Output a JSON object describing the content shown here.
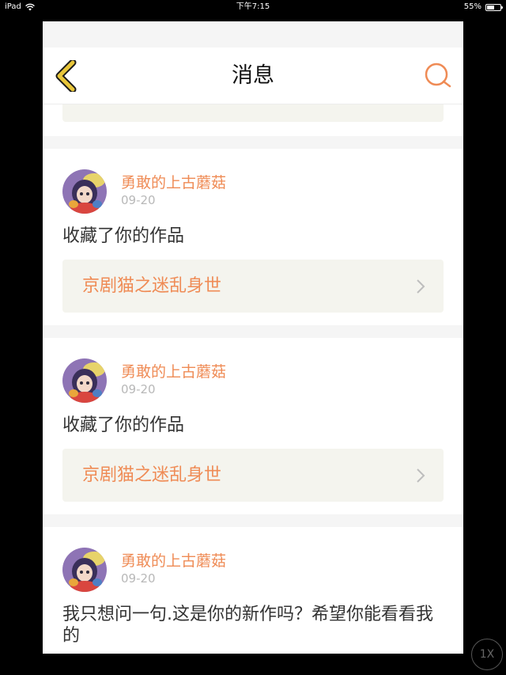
{
  "status_bar": {
    "device": "iPad",
    "time": "下午7:15",
    "battery": "55%",
    "battery_level": 0.55
  },
  "navbar": {
    "title": "消息",
    "back_icon": "chevron-left-icon",
    "search_icon": "search-icon"
  },
  "colors": {
    "accent": "#ef8b55",
    "back_arrow": "#e8c63a",
    "card_bg": "#f4f4ee"
  },
  "messages": [
    {
      "username": "勇敢的上古蘑菇",
      "date": "09-20",
      "text": "收藏了你的作品",
      "work_title": "京剧猫之迷乱身世"
    },
    {
      "username": "勇敢的上古蘑菇",
      "date": "09-20",
      "text": "收藏了你的作品",
      "work_title": "京剧猫之迷乱身世"
    },
    {
      "username": "勇敢的上古蘑菇",
      "date": "09-20",
      "text": "我只想问一句.这是你的新作吗？希望你能看看我的"
    }
  ],
  "zoom_button": {
    "label": "1X"
  }
}
